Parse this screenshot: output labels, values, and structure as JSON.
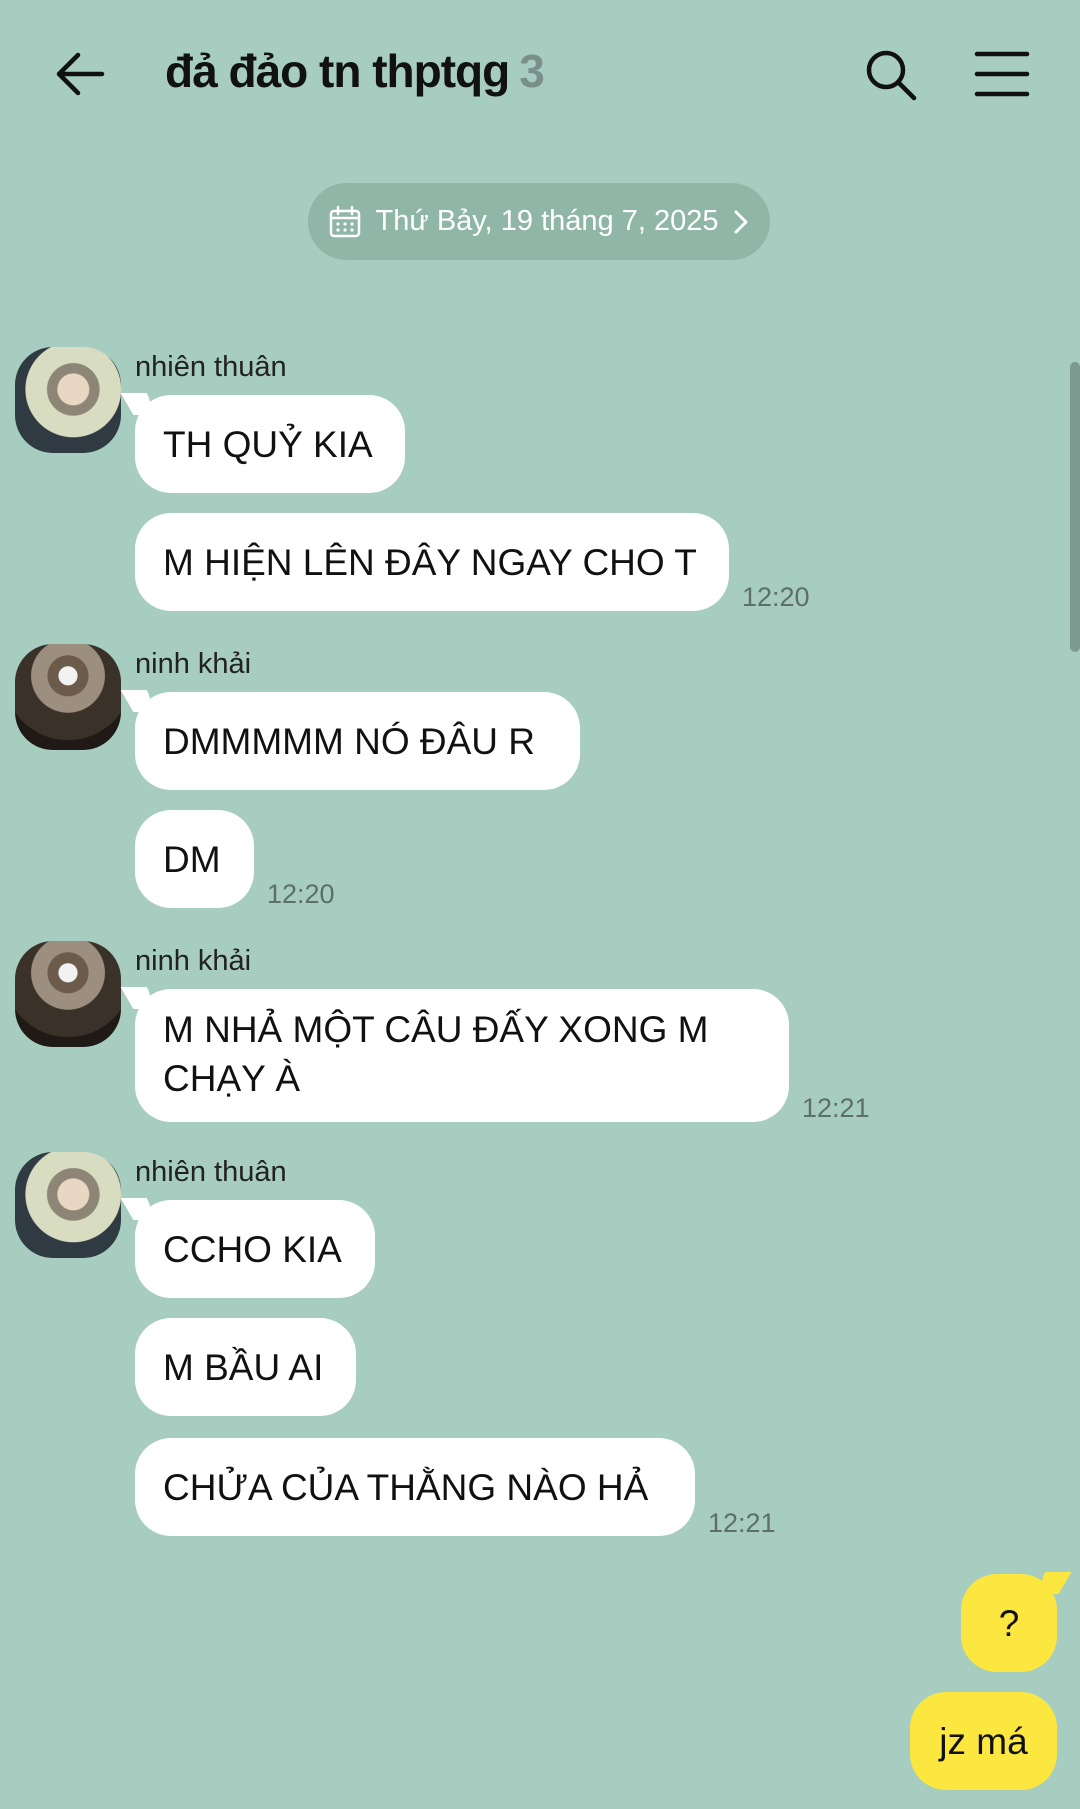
{
  "header": {
    "title": "đả đảo tn thptqg",
    "member_count": "3"
  },
  "date_divider": "Thứ Bảy, 19 tháng 7, 2025",
  "messages": [
    {
      "sender": "nhiên thuân",
      "bubbles": [
        "TH QUỶ KIA",
        "M HIỆN LÊN ĐÂY NGAY CHO T"
      ],
      "time": "12:20"
    },
    {
      "sender": "ninh khải",
      "bubbles": [
        "DMMMMM NÓ ĐÂU R",
        "DM"
      ],
      "time": "12:20"
    },
    {
      "sender": "ninh khải",
      "bubbles": [
        "M NHẢ MỘT CÂU ĐẤY XONG M CHẠY À"
      ],
      "time": "12:21"
    },
    {
      "sender": "nhiên thuân",
      "bubbles": [
        "CCHO KIA",
        "M BẦU AI",
        "CHỬA CỦA THẰNG NÀO HẢ"
      ],
      "time": "12:21"
    }
  ],
  "my_messages": [
    "?",
    "jz má"
  ],
  "colors": {
    "background": "#a6cdbf",
    "incoming_bubble": "#ffffff",
    "outgoing_bubble": "#fbe73f",
    "date_pill": "#90b6a8"
  }
}
